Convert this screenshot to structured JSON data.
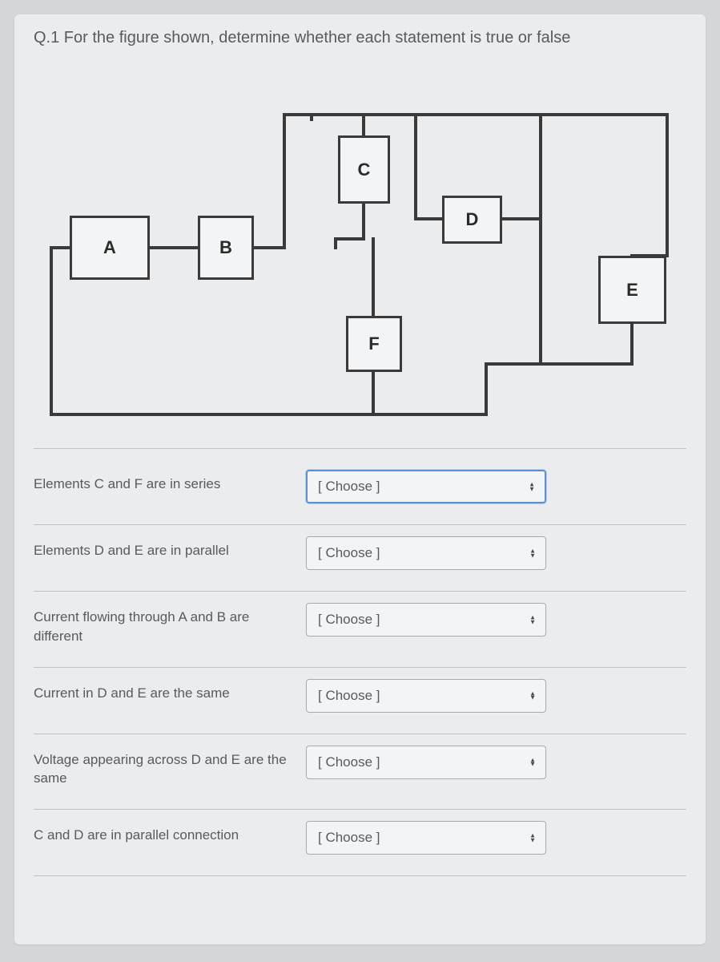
{
  "question_title": "Q.1 For the figure shown, determine whether each statement is true or false",
  "circuit_labels": {
    "A": "A",
    "B": "B",
    "C": "C",
    "D": "D",
    "E": "E",
    "F": "F"
  },
  "dropdown_placeholder": "[ Choose ]",
  "statements": [
    {
      "text": "Elements C and F are in series",
      "value": "[ Choose ]",
      "focused": true
    },
    {
      "text": "Elements D and E are in parallel",
      "value": "[ Choose ]",
      "focused": false
    },
    {
      "text": "Current flowing through A and B are different",
      "value": "[ Choose ]",
      "focused": false
    },
    {
      "text": "Current in D and E are the same",
      "value": "[ Choose ]",
      "focused": false
    },
    {
      "text": "Voltage appearing across D and E are the same",
      "value": "[ Choose ]",
      "focused": false
    },
    {
      "text": "C and D are in parallel connection",
      "value": "[ Choose ]",
      "focused": false
    }
  ]
}
